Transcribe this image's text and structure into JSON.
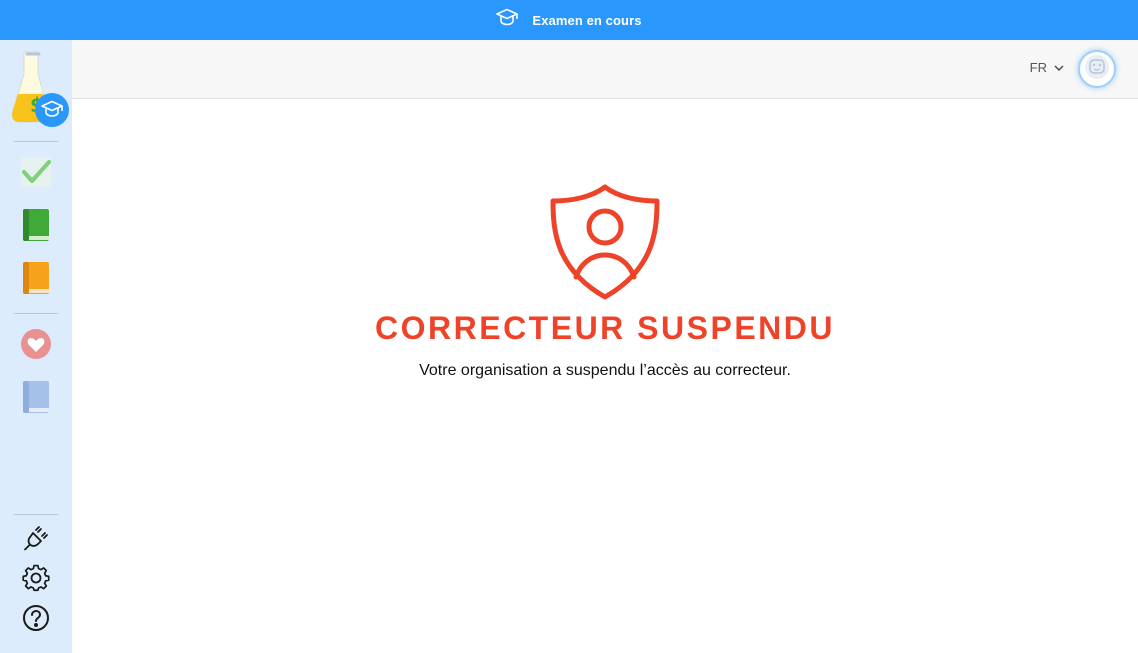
{
  "banner": {
    "title": "Examen en cours",
    "icon": "graduation-cap-icon",
    "color": "#2997fb"
  },
  "sidebar": {
    "logo_icon": "flask-graduation-logo",
    "items": [
      {
        "icon": "checkmark-icon"
      },
      {
        "icon": "green-book-icon"
      },
      {
        "icon": "orange-book-icon"
      },
      {
        "icon": "heart-icon"
      },
      {
        "icon": "blue-book-icon"
      }
    ],
    "bottom_items": [
      {
        "icon": "plug-icon"
      },
      {
        "icon": "gear-icon"
      },
      {
        "icon": "help-icon"
      }
    ]
  },
  "topbar": {
    "language": "FR",
    "language_icon": "chevron-down-icon",
    "avatar_icon": "user-avatar-icon"
  },
  "main": {
    "icon": "shield-user-icon",
    "heading": "CORRECTEUR SUSPENDU",
    "message": "Votre organisation a suspendu l’accès au correcteur.",
    "accent_color": "#ee4328"
  }
}
